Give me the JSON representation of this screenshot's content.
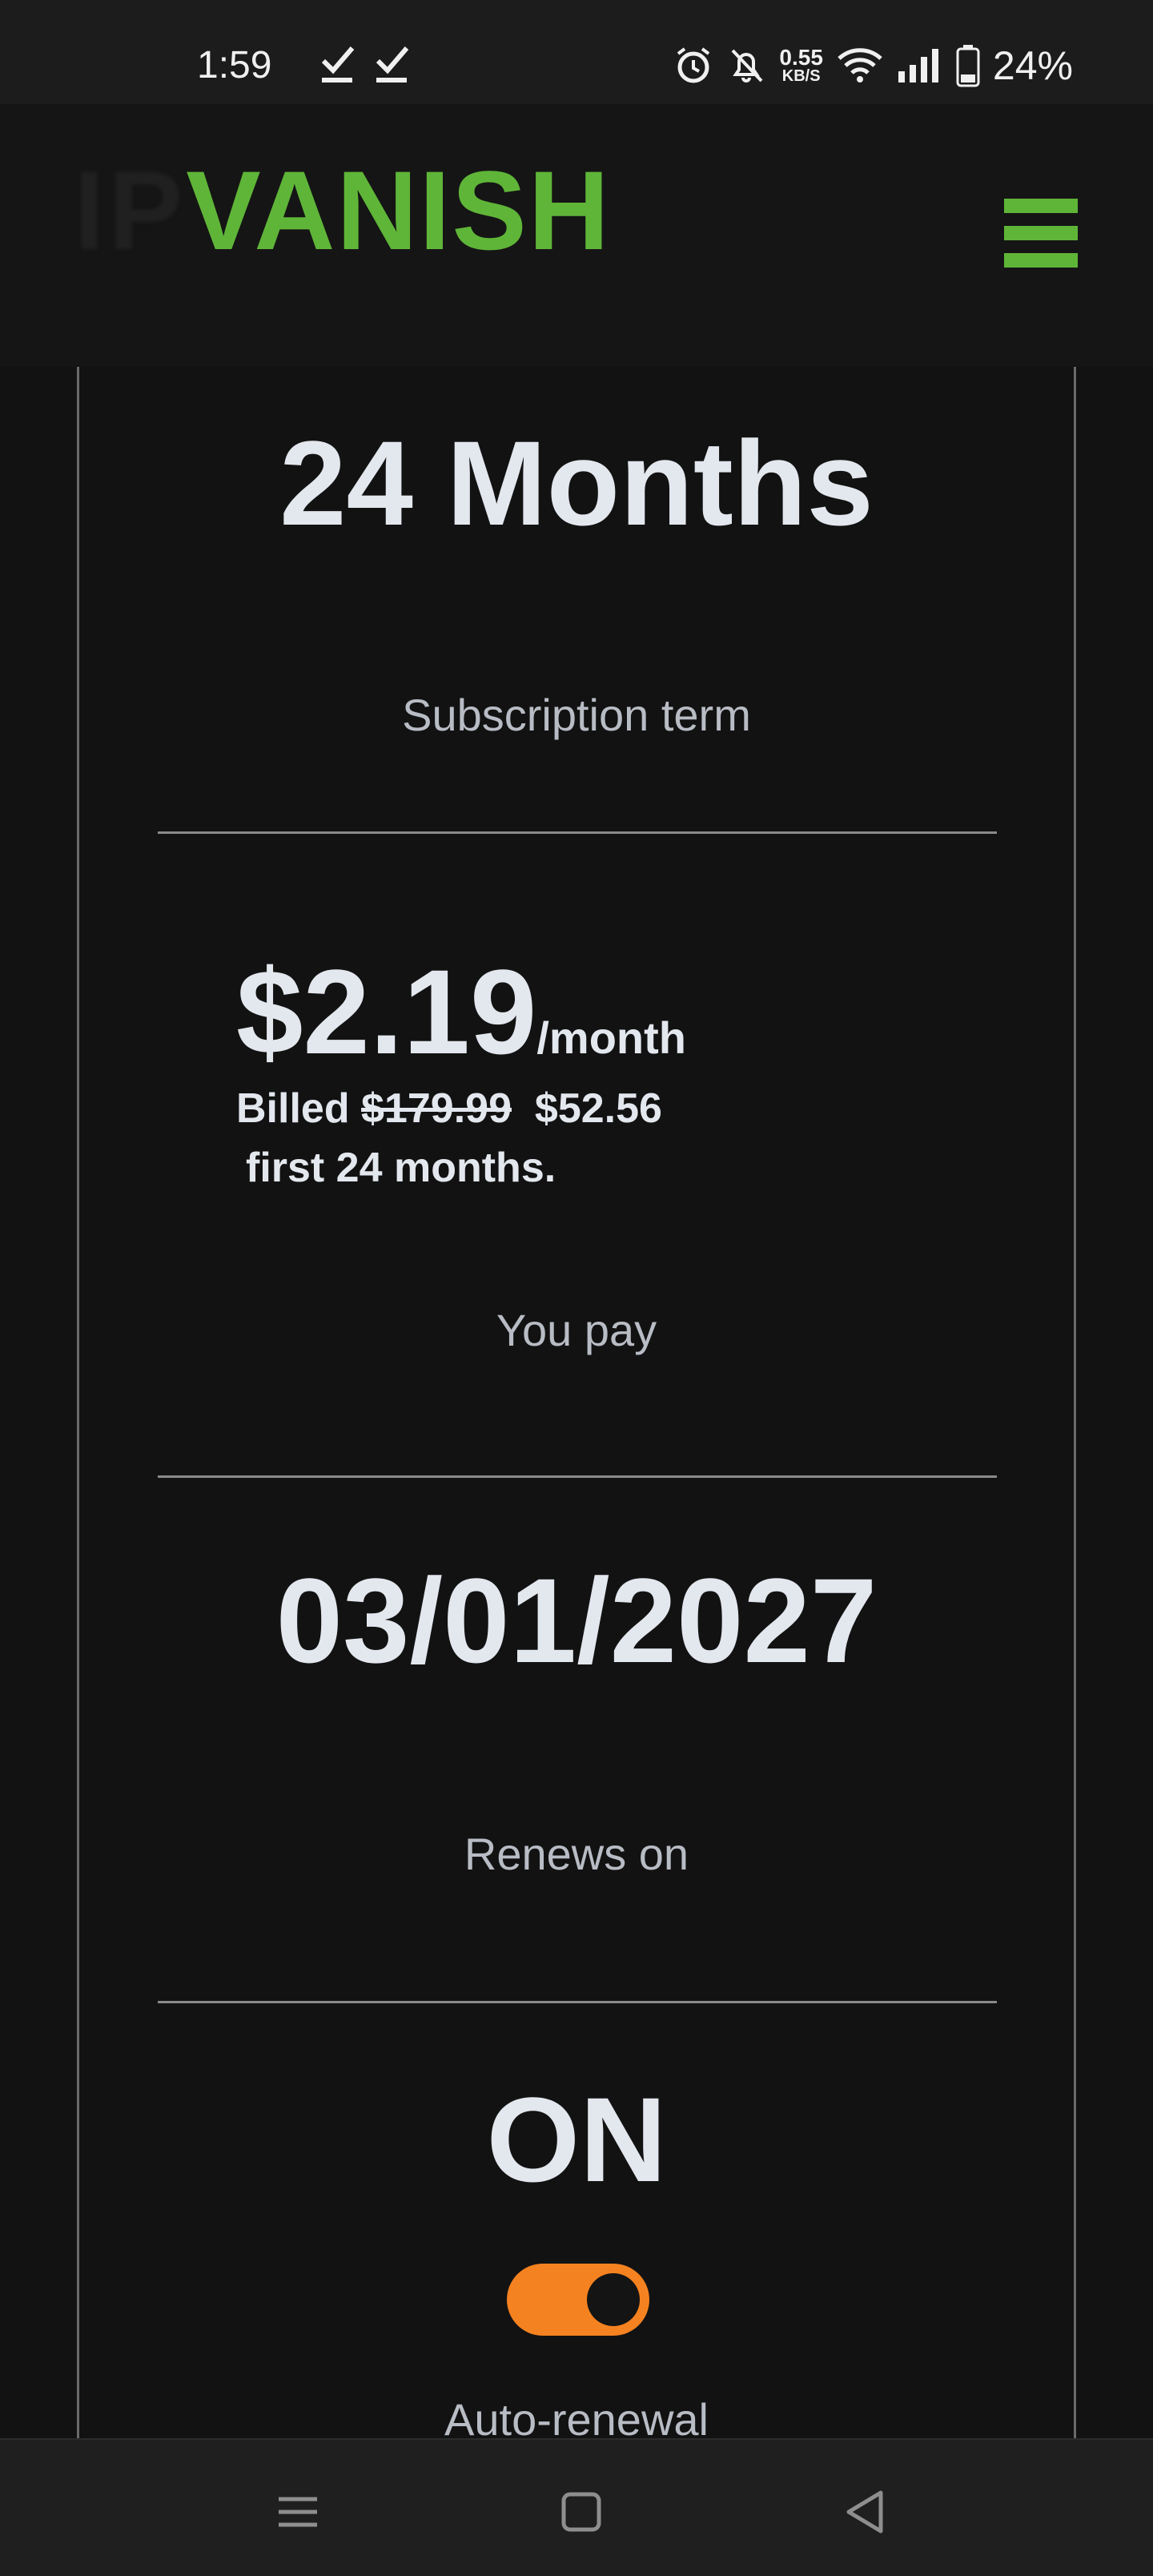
{
  "status_bar": {
    "time": "1:59",
    "net_speed_value": "0.55",
    "net_speed_unit": "KB/S",
    "battery_percent": "24%",
    "icons": [
      "check-icon",
      "check-icon",
      "alarm-icon",
      "bell-muted-icon",
      "wifi-icon",
      "signal-icon",
      "battery-icon"
    ]
  },
  "header": {
    "logo_ip": "IP",
    "logo_vanish": "VANISH",
    "menu_icon": "hamburger-menu-icon",
    "brand_color": "#5fb538"
  },
  "subscription": {
    "term_value": "24 Months",
    "term_label": "Subscription term",
    "price": "$2.19",
    "price_unit": "/month",
    "billed_prefix": "Billed",
    "billed_old_price": "$179.99",
    "billed_new_price": "$52.56",
    "billed_suffix": "first 24 months.",
    "you_pay_label": "You pay",
    "renew_date": "03/01/2027",
    "renew_label": "Renews on",
    "auto_renew_status": "ON",
    "auto_renew_enabled": true,
    "auto_renew_label": "Auto-renewal",
    "toggle_color": "#f58220"
  },
  "nav_bar": {
    "icons": [
      "recent-apps-icon",
      "home-icon",
      "back-icon"
    ]
  }
}
